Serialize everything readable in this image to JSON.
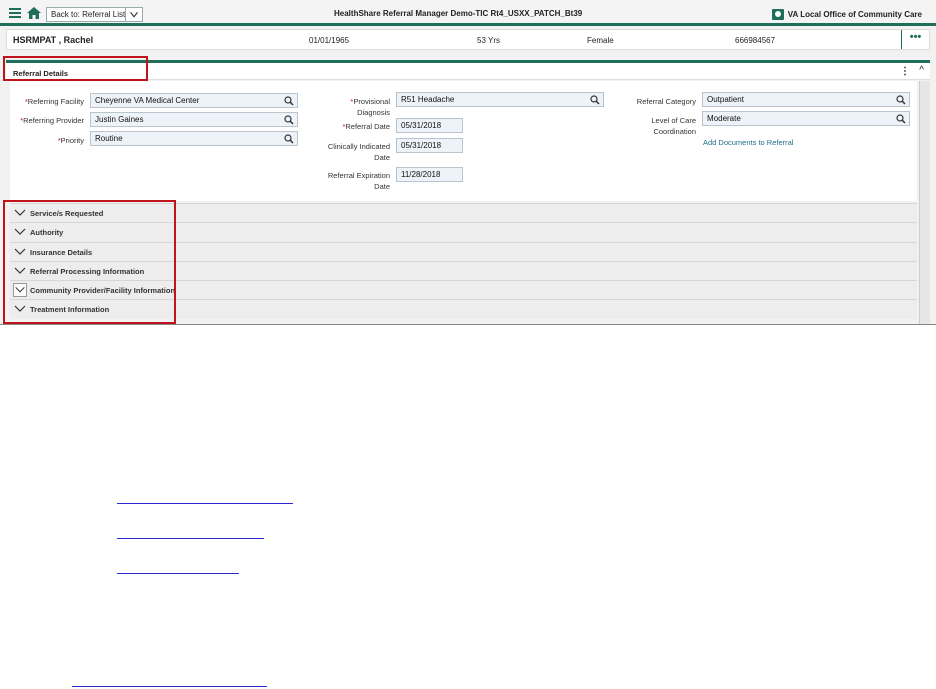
{
  "topbar": {
    "back_label": "Back to: Referral List",
    "app_title": "HealthShare Referral Manager Demo-TIC Rt4_USXX_PATCH_Bt39",
    "org_label": "VA Local Office of Community Care",
    "icons": {
      "menu": "hamburger-icon",
      "home": "home-icon",
      "caret": "chevron-down-icon",
      "org": "contact-card-icon"
    }
  },
  "patient": {
    "name": "HSRMPAT , Rachel",
    "dob": "01/01/1965",
    "age": "53 Yrs",
    "sex": "Female",
    "id": "666984567",
    "more": "•••"
  },
  "referral_details": {
    "title": "Referral Details",
    "kebab": "⋮",
    "collapse": "^",
    "fields": {
      "referring_facility": {
        "label": "Referring Facility",
        "value": "Cheyenne VA Medical Center"
      },
      "referring_provider": {
        "label": "Referring Provider",
        "value": "Justin Gaines"
      },
      "priority": {
        "label": "Priority",
        "value": "Routine"
      },
      "provisional_diagnosis": {
        "label_1": "Provisional",
        "label_2": "Diagnosis",
        "value": "R51 Headache"
      },
      "referral_date": {
        "label": "Referral Date",
        "value": "05/31/2018"
      },
      "clinically_indicated_date": {
        "label_1": "Clinically Indicated",
        "label_2": "Date",
        "value": "05/31/2018"
      },
      "referral_expiration_date": {
        "label_1": "Referral Expiration",
        "label_2": "Date",
        "value": "11/28/2018"
      },
      "referral_category": {
        "label": "Referral Category",
        "value": "Outpatient"
      },
      "level_of_care": {
        "label_1": "Level of Care",
        "label_2": "Coordination",
        "value": "Moderate"
      }
    },
    "add_documents": "Add Documents to Referral",
    "required_marker": "*"
  },
  "accordion": [
    {
      "label": "Service/s Requested"
    },
    {
      "label": "Authority"
    },
    {
      "label": "Insurance Details"
    },
    {
      "label": "Referral Processing Information"
    },
    {
      "label": "Community Provider/Facility Information"
    },
    {
      "label": "Treatment Information"
    }
  ],
  "colors": {
    "accent": "#1f6e5a",
    "highlight": "#c0141c",
    "link": "#2a2ad0"
  }
}
